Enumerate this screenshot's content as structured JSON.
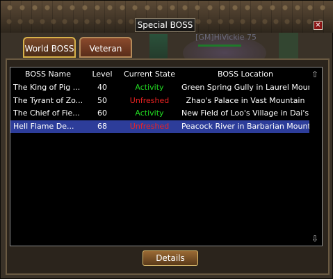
{
  "window": {
    "title": "Special BOSS",
    "close_glyph": "✕"
  },
  "scene": {
    "player_label": "[GM]HiVickie  75"
  },
  "tabs": [
    {
      "label": "World BOSS",
      "active": true
    },
    {
      "label": "Veteran",
      "active": false
    }
  ],
  "table": {
    "columns": [
      "BOSS Name",
      "Level",
      "Current State",
      "BOSS Location"
    ],
    "rows": [
      {
        "name": "The King of Pig ...",
        "level": "40",
        "state": "Activity",
        "location": "Green Spring Gully in Laurel Mounta",
        "state_color": "#22dd22",
        "selected": false
      },
      {
        "name": "The Tyrant of Zo...",
        "level": "50",
        "state": "Unfreshed",
        "location": "Zhao's Palace in Vast Mountain",
        "state_color": "#ee2222",
        "selected": false
      },
      {
        "name": "The Chief of Fie...",
        "level": "60",
        "state": "Activity",
        "location": "New Field of Loo's Village in Dai's Fi",
        "state_color": "#22dd22",
        "selected": false
      },
      {
        "name": "Hell Flame De...",
        "level": "68",
        "state": "Unfreshed",
        "location": "Peacock River in Barbarian Mountai",
        "state_color": "#ee2222",
        "selected": true
      }
    ]
  },
  "scroll": {
    "up_glyph": "⇧",
    "down_glyph": "⇩"
  },
  "buttons": {
    "details": "Details"
  }
}
